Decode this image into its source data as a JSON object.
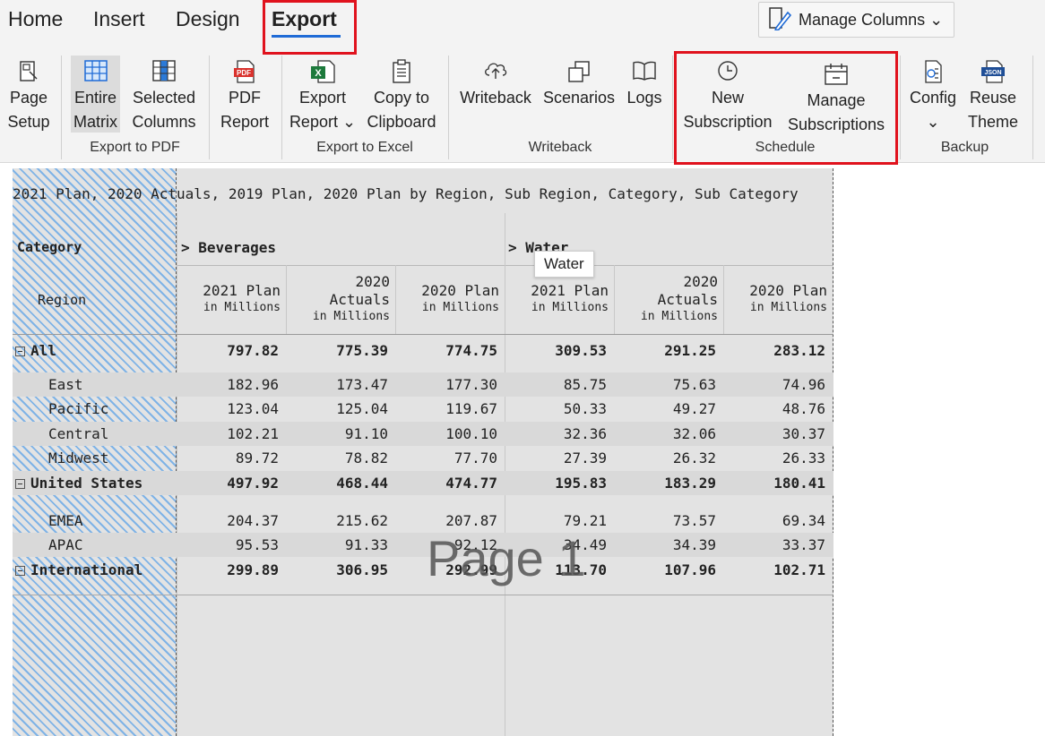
{
  "tabs": [
    {
      "label": "Home"
    },
    {
      "label": "Insert"
    },
    {
      "label": "Design"
    },
    {
      "label": "Export"
    }
  ],
  "manage_columns": {
    "label": "Manage Columns ⌄"
  },
  "ribbon": {
    "page_setup": [
      "Page",
      "Setup"
    ],
    "entire_matrix": [
      "Entire",
      "Matrix"
    ],
    "selected_columns": [
      "Selected",
      "Columns"
    ],
    "pdf_report": [
      "PDF",
      "Report"
    ],
    "export_report": [
      "Export",
      "Report ⌄"
    ],
    "copy_clipboard": [
      "Copy to",
      "Clipboard"
    ],
    "writeback": [
      "Writeback"
    ],
    "scenarios": [
      "Scenarios"
    ],
    "logs": [
      "Logs"
    ],
    "new_subscription": [
      "New",
      "Subscription"
    ],
    "manage_subscriptions": [
      "Manage",
      "Subscriptions"
    ],
    "config": [
      "Config",
      "⌄"
    ],
    "reuse_theme": [
      "Reuse",
      "Theme"
    ],
    "groups": {
      "export_pdf": "Export to PDF",
      "export_excel": "Export to Excel",
      "writeback": "Writeback",
      "schedule": "Schedule",
      "backup": "Backup"
    },
    "icon_text": {
      "pdf": "PDF",
      "excel": "X",
      "json": "JSON"
    }
  },
  "report": {
    "title": "2021 Plan, 2020 Actuals, 2019 Plan, 2020 Plan by Region, Sub Region, Category, Sub Category",
    "category_label": "Category",
    "region_label": "Region",
    "groups": [
      "Beverages",
      "Water"
    ],
    "columns": [
      {
        "name": "2021 Plan",
        "unit": "in Millions"
      },
      {
        "name": "2020 Actuals",
        "unit": "in Millions"
      },
      {
        "name": "2020 Plan",
        "unit": "in Millions"
      },
      {
        "name": "2021 Plan",
        "unit": "in Millions"
      },
      {
        "name": "2020 Actuals",
        "unit": "in Millions"
      },
      {
        "name": "2020 Plan",
        "unit": "in Millions"
      }
    ],
    "rows": [
      {
        "label": "All",
        "values": [
          "797.82",
          "775.39",
          "774.75",
          "309.53",
          "291.25",
          "283.12"
        ]
      },
      {
        "label": "East",
        "values": [
          "182.96",
          "173.47",
          "177.30",
          "85.75",
          "75.63",
          "74.96"
        ]
      },
      {
        "label": "Pacific",
        "values": [
          "123.04",
          "125.04",
          "119.67",
          "50.33",
          "49.27",
          "48.76"
        ]
      },
      {
        "label": "Central",
        "values": [
          "102.21",
          "91.10",
          "100.10",
          "32.36",
          "32.06",
          "30.37"
        ]
      },
      {
        "label": "Midwest",
        "values": [
          "89.72",
          "78.82",
          "77.70",
          "27.39",
          "26.32",
          "26.33"
        ]
      },
      {
        "label": "United States",
        "values": [
          "497.92",
          "468.44",
          "474.77",
          "195.83",
          "183.29",
          "180.41"
        ]
      },
      {
        "label": "EMEA",
        "values": [
          "204.37",
          "215.62",
          "207.87",
          "79.21",
          "73.57",
          "69.34"
        ]
      },
      {
        "label": "APAC",
        "values": [
          "95.53",
          "91.33",
          "92.12",
          "34.49",
          "34.39",
          "33.37"
        ]
      },
      {
        "label": "International",
        "values": [
          "299.89",
          "306.95",
          "292.99",
          "113.70",
          "107.96",
          "102.71"
        ]
      }
    ],
    "watermark": "Page 1",
    "tooltip": "Water"
  }
}
